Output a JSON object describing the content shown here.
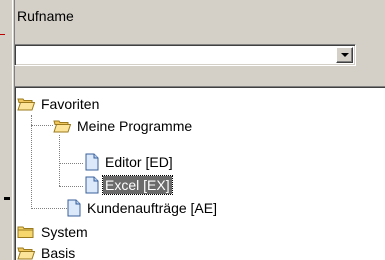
{
  "form": {
    "label": "Rufname",
    "combo_value": ""
  },
  "tree": {
    "items": [
      {
        "label": "Favoriten",
        "icon": "folder-open-icon"
      },
      {
        "label": "Meine Programme",
        "icon": "folder-open-icon"
      },
      {
        "label": "Editor  [ED]",
        "icon": "document-icon"
      },
      {
        "label": "Excel  [EX]",
        "icon": "document-icon",
        "selected": true
      },
      {
        "label": "Kundenaufträge  [AE]",
        "icon": "document-icon"
      },
      {
        "label": "System",
        "icon": "folder-closed-icon"
      },
      {
        "label": "Basis",
        "icon": "folder-closed-icon"
      }
    ]
  },
  "colors": {
    "background": "#d4d0c8",
    "selection": "#6b6b6b",
    "folder": "#f5d76e",
    "document": "#dbe9fb"
  }
}
